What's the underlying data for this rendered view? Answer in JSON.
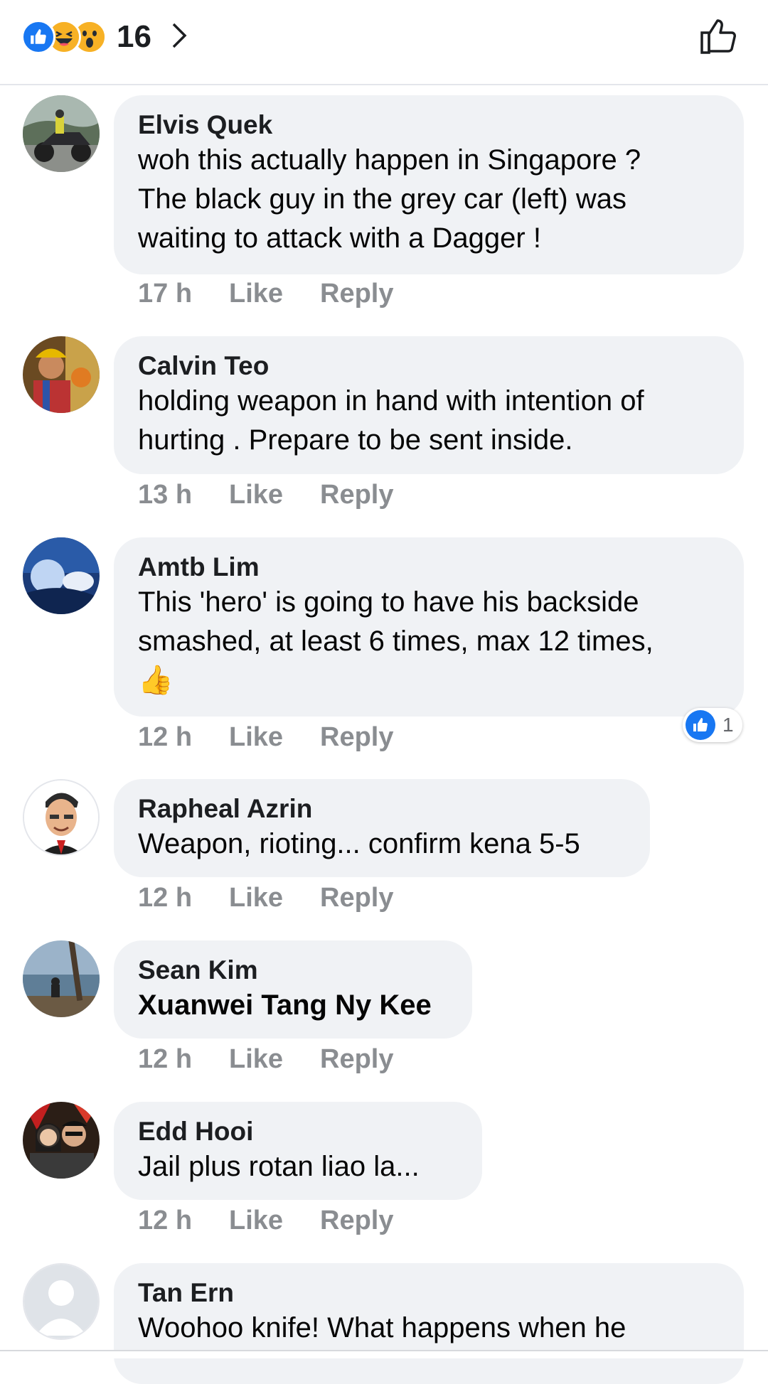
{
  "header": {
    "reaction_count": "16",
    "reaction_icons": [
      "like-icon",
      "haha-icon",
      "wow-icon"
    ]
  },
  "comments": [
    {
      "author": "Elvis Quek",
      "lines": [
        "woh this actually happen in Singapore ?",
        "The black guy in the grey car (left) was",
        "waiting to attack with a Dagger !"
      ],
      "time": "17 h",
      "like_label": "Like",
      "reply_label": "Reply"
    },
    {
      "author": "Calvin Teo",
      "lines": [
        "holding weapon in hand with intention of",
        "hurting . Prepare to be sent inside."
      ],
      "time": "13 h",
      "like_label": "Like",
      "reply_label": "Reply"
    },
    {
      "author": "Amtb Lim",
      "lines": [
        "This 'hero' is going to have his backside",
        "smashed, at least 6 times, max 12 times,"
      ],
      "emoji": "👍",
      "time": "12 h",
      "like_label": "Like",
      "reply_label": "Reply",
      "reaction_count": "1"
    },
    {
      "author": "Rapheal Azrin",
      "lines": [
        "Weapon, rioting... confirm kena 5-5"
      ],
      "time": "12 h",
      "like_label": "Like",
      "reply_label": "Reply"
    },
    {
      "author": "Sean Kim",
      "lines": [
        "Xuanwei Tang Ny Kee"
      ],
      "time": "12 h",
      "like_label": "Like",
      "reply_label": "Reply"
    },
    {
      "author": "Edd Hooi",
      "lines": [
        "Jail plus rotan liao la..."
      ],
      "time": "12 h",
      "like_label": "Like",
      "reply_label": "Reply"
    },
    {
      "author": "Tan Ern",
      "lines": [
        "Woohoo knife! What happens when he"
      ]
    }
  ],
  "colors": {
    "bubble": "#f0f2f5",
    "meta": "#8a8d91",
    "accent": "#1877f2"
  }
}
